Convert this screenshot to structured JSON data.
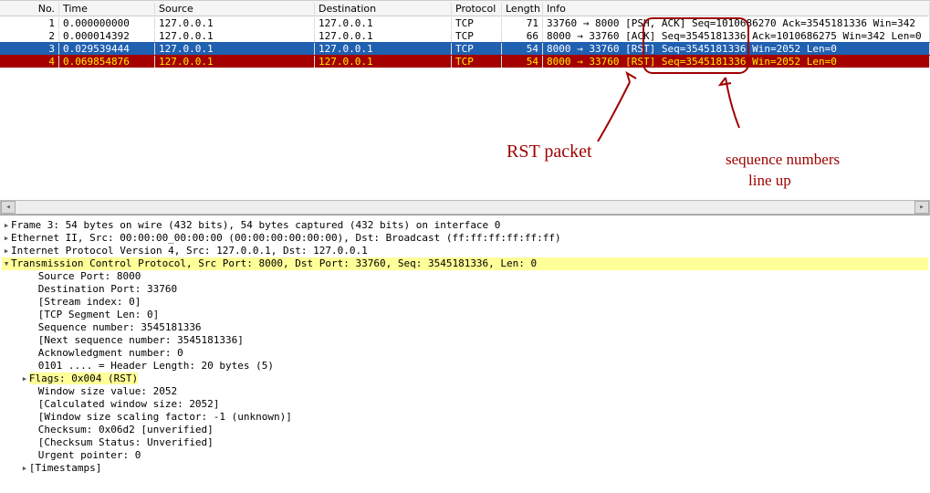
{
  "columns": {
    "no": "No.",
    "time": "Time",
    "src": "Source",
    "dst": "Destination",
    "proto": "Protocol",
    "len": "Length",
    "info": "Info"
  },
  "packets": [
    {
      "no": "1",
      "time": "0.000000000",
      "src": "127.0.0.1",
      "dst": "127.0.0.1",
      "proto": "TCP",
      "len": "71",
      "info": "33760 → 8000 [PSH, ACK] Seq=1010686270 Ack=3545181336 Win=342"
    },
    {
      "no": "2",
      "time": "0.000014392",
      "src": "127.0.0.1",
      "dst": "127.0.0.1",
      "proto": "TCP",
      "len": "66",
      "info": "8000 → 33760 [ACK] Seq=3545181336 Ack=1010686275 Win=342 Len=0"
    },
    {
      "no": "3",
      "time": "0.029539444",
      "src": "127.0.0.1",
      "dst": "127.0.0.1",
      "proto": "TCP",
      "len": "54",
      "info": "8000 → 33760 [RST] Seq=3545181336 Win=2052 Len=0"
    },
    {
      "no": "4",
      "time": "0.069854876",
      "src": "127.0.0.1",
      "dst": "127.0.0.1",
      "proto": "TCP",
      "len": "54",
      "info": "8000 → 33760 [RST] Seq=3545181336 Win=2052 Len=0"
    }
  ],
  "details": {
    "frame": "Frame 3: 54 bytes on wire (432 bits), 54 bytes captured (432 bits) on interface 0",
    "eth": "Ethernet II, Src: 00:00:00_00:00:00 (00:00:00:00:00:00), Dst: Broadcast (ff:ff:ff:ff:ff:ff)",
    "ip": "Internet Protocol Version 4, Src: 127.0.0.1, Dst: 127.0.0.1",
    "tcp": "Transmission Control Protocol, Src Port: 8000, Dst Port: 33760, Seq: 3545181336, Len: 0",
    "src_port": "Source Port: 8000",
    "dst_port": "Destination Port: 33760",
    "stream": "[Stream index: 0]",
    "seglen": "[TCP Segment Len: 0]",
    "seq": "Sequence number: 3545181336",
    "nextseq": "[Next sequence number: 3545181336]",
    "ack": "Acknowledgment number: 0",
    "hdrlen": "0101 .... = Header Length: 20 bytes (5)",
    "flags": "Flags: 0x004 (RST)",
    "win": "Window size value: 2052",
    "calcwin": "[Calculated window size: 2052]",
    "scale": "[Window size scaling factor: -1 (unknown)]",
    "cksum": "Checksum: 0x06d2 [unverified]",
    "cksumst": "[Checksum Status: Unverified]",
    "urg": "Urgent pointer: 0",
    "ts": "[Timestamps]"
  },
  "annotations": {
    "rst": "RST packet",
    "seq1": "sequence numbers",
    "seq2": "line up"
  }
}
